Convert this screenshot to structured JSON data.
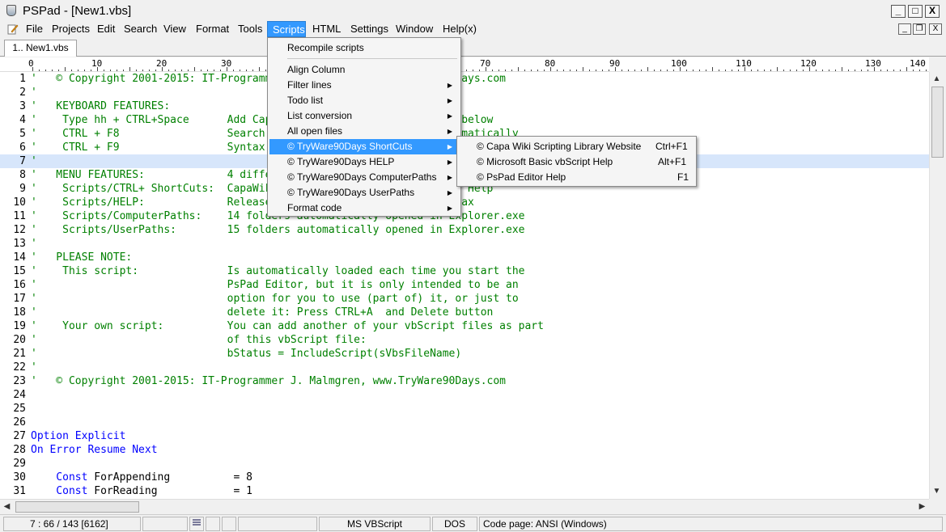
{
  "window": {
    "app_name": "PSPad",
    "title": "PSPad - [New1.vbs]",
    "controls": {
      "minimize": "_",
      "maximize": "□",
      "close": "X"
    },
    "mdi_controls": {
      "minimize": "_",
      "restore": "❐",
      "close": "X"
    }
  },
  "menu": [
    {
      "label": "File"
    },
    {
      "label": "Projects"
    },
    {
      "label": "Edit"
    },
    {
      "label": "Search"
    },
    {
      "label": "View"
    },
    {
      "label": "Format"
    },
    {
      "label": "Tools"
    },
    {
      "label": "Scripts"
    },
    {
      "label": "HTML"
    },
    {
      "label": "Settings"
    },
    {
      "label": "Window"
    },
    {
      "label": "Help(x)"
    }
  ],
  "active_menu": "Scripts",
  "tabs": [
    {
      "label": "1.. New1.vbs"
    }
  ],
  "ruler": [
    "0",
    "10",
    "20",
    "30",
    "40",
    "50",
    "60",
    "70",
    "80",
    "90",
    "100",
    "110",
    "120",
    "130",
    "140"
  ],
  "scripts_menu": {
    "items": [
      {
        "label": "Recompile scripts"
      },
      {
        "label": "Align Column"
      },
      {
        "label": "Filter lines"
      },
      {
        "label": "Todo list"
      },
      {
        "label": "List conversion"
      },
      {
        "label": "All open files"
      },
      {
        "label": "© TryWare90Days ShortCuts"
      },
      {
        "label": "© TryWare90Days HELP"
      },
      {
        "label": "© TryWare90Days ComputerPaths"
      },
      {
        "label": "© TryWare90Days UserPaths"
      },
      {
        "label": "Format code"
      }
    ],
    "highlighted": "© TryWare90Days ShortCuts"
  },
  "shortcuts_submenu": [
    {
      "label": "© Capa Wiki Scripting Library Website",
      "shortcut": "Ctrl+F1"
    },
    {
      "label": "© Microsoft Basic vbScript Help",
      "shortcut": "Alt+F1"
    },
    {
      "label": "© PsPad Editor Help",
      "shortcut": "F1"
    }
  ],
  "editor": {
    "current_line": 7,
    "lines": [
      {
        "num": "1",
        "text": "'   © Copyright 2001-2015: IT-Programmer J. Malmgren, www.TryWare90Days.com"
      },
      {
        "num": "2",
        "text": "'"
      },
      {
        "num": "3",
        "text": "'   KEYBOARD FEATURES:"
      },
      {
        "num": "4",
        "text": "'    Type hh + CTRL+Space      Add Capa Wiki Scripting Library, see below"
      },
      {
        "num": "5",
        "text": "'    CTRL + F8                 Search...                 loaded automatically"
      },
      {
        "num": "6",
        "text": "'    CTRL + F9                 Syntax..."
      },
      {
        "num": "7",
        "text": "'"
      },
      {
        "num": "8",
        "text": "'   MENU FEATURES:             4 different..."
      },
      {
        "num": "9",
        "text": "'    Scripts/CTRL+ ShortCuts:  CapaWiki...   ...om, and PsPad Editor Help"
      },
      {
        "num": "10",
        "text": "'    Scripts/HELP:             Release...                 ...ScrSyntax"
      },
      {
        "num": "11",
        "text": "'    Scripts/ComputerPaths:    14 folders automatically opened in Explorer.exe"
      },
      {
        "num": "12",
        "text": "'    Scripts/UserPaths:        15 folders automatically opened in Explorer.exe"
      },
      {
        "num": "13",
        "text": "'"
      },
      {
        "num": "14",
        "text": "'   PLEASE NOTE:"
      },
      {
        "num": "15",
        "text": "'    This script:              Is automatically loaded each time you start the"
      },
      {
        "num": "16",
        "text": "'                              PsPad Editor, but it is only intended to be an"
      },
      {
        "num": "17",
        "text": "'                              option for you to use (part of) it, or just to"
      },
      {
        "num": "18",
        "text": "'                              delete it: Press CTRL+A  and Delete button"
      },
      {
        "num": "19",
        "text": "'    Your own script:          You can add another of your vbScript files as part"
      },
      {
        "num": "20",
        "text": "'                              of this vbScript file:"
      },
      {
        "num": "21",
        "text": "'                              bStatus = IncludeScript(sVbsFileName)"
      },
      {
        "num": "22",
        "text": "'"
      },
      {
        "num": "23",
        "text": "'   © Copyright 2001-2015: IT-Programmer J. Malmgren, www.TryWare90Days.com"
      },
      {
        "num": "24",
        "text": ""
      },
      {
        "num": "25",
        "text": ""
      },
      {
        "num": "26",
        "text": ""
      },
      {
        "num": "27",
        "text": "Option Explicit"
      },
      {
        "num": "28",
        "text": "On Error Resume Next"
      },
      {
        "num": "29",
        "text": ""
      },
      {
        "num": "30",
        "text": "    Const ForAppending          = 8",
        "kw": "    Const ",
        "ident": "ForAppending          = 8"
      },
      {
        "num": "31",
        "text": "    Const ForReading            = 1",
        "kw": "    Const ",
        "ident": "ForReading            = 1"
      }
    ]
  },
  "status": {
    "position": "7 : 66 / 143  [6162]",
    "syntax": "MS VBScript",
    "line_end": "DOS",
    "codepage": "Code page: ANSI (Windows)"
  },
  "colors": {
    "comment": "#008000",
    "keyword": "#0000ff",
    "menu_highlight": "#3399ff",
    "current_line": "#d7e6fb"
  }
}
